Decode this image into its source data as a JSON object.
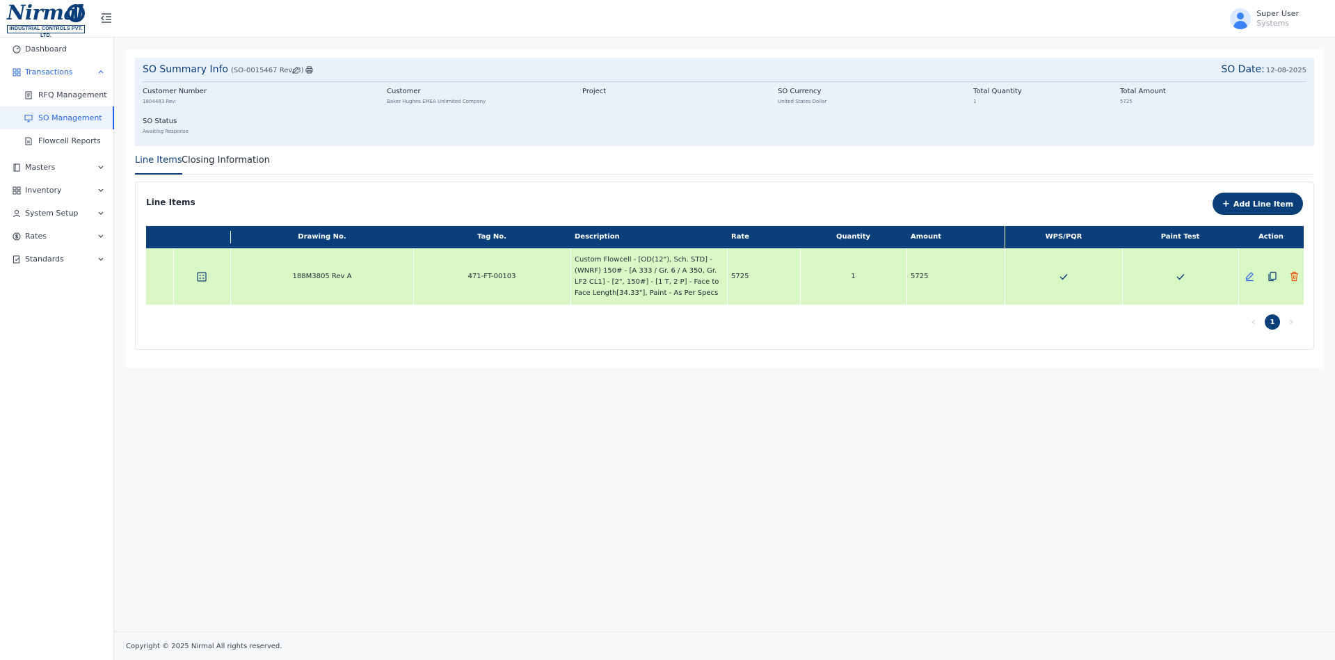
{
  "brand": {
    "logo_word": "Nirmal",
    "logo_sub": "INDUSTRIAL CONTROLS PVT. LTD."
  },
  "header": {
    "user_name": "Super User",
    "user_role": "Systems"
  },
  "sidebar": {
    "items": [
      {
        "label": "Dashboard",
        "icon": "dashboard-icon"
      },
      {
        "label": "Transactions",
        "icon": "grid-icon"
      },
      {
        "label": "RFQ Management",
        "icon": "document-icon"
      },
      {
        "label": "SO Management",
        "icon": "monitor-icon"
      },
      {
        "label": "Flowcell Reports",
        "icon": "report-icon"
      },
      {
        "label": "Masters",
        "icon": "book-icon"
      },
      {
        "label": "Inventory",
        "icon": "grid-icon"
      },
      {
        "label": "System Setup",
        "icon": "user-icon"
      },
      {
        "label": "Rates",
        "icon": "currency-icon"
      },
      {
        "label": "Standards",
        "icon": "standards-icon"
      }
    ]
  },
  "summary": {
    "title": "SO Summary Info",
    "so_ref": "(SO-0015467 Rev: 3)",
    "date_label": "SO Date:",
    "date_value": "12-08-2025",
    "fields": [
      {
        "label": "Customer Number",
        "value": "1804483 Rev:"
      },
      {
        "label": "Customer",
        "value": "Baker Hughes EMEA Unlimited Company"
      },
      {
        "label": "Project",
        "value": ""
      },
      {
        "label": "SO Currency",
        "value": "United States Dollar"
      },
      {
        "label": "Total Quantity",
        "value": "1"
      },
      {
        "label": "Total Amount",
        "value": "5725"
      },
      {
        "label": "SO Status",
        "value": "Awaiting Response"
      }
    ]
  },
  "tabs": [
    {
      "label": "Line Items",
      "active": true
    },
    {
      "label": "Closing Information",
      "active": false
    }
  ],
  "line_items": {
    "title": "Line Items",
    "add_label": "Add Line Item",
    "columns": {
      "drawing": "Drawing No.",
      "tag": "Tag No.",
      "description": "Description",
      "rate": "Rate",
      "quantity": "Quantity",
      "amount": "Amount",
      "wps": "WPS/PQR",
      "paint": "Paint Test",
      "action": "Action"
    },
    "rows": [
      {
        "drawing": "188M3805 Rev A",
        "tag": "471-FT-00103",
        "description": "Custom Flowcell - [OD(12\"), Sch. STD] - (WNRF) 150# - [A 333 / Gr. 6 / A 350, Gr. LF2 CL1] - [2\", 150#] - [1 T, 2 P] - Face to Face Length[34.33\"], Paint - As Per Specs",
        "rate": "5725",
        "quantity": "1",
        "amount": "5725",
        "wps_ok": true,
        "paint_ok": true
      }
    ],
    "current_page": "1"
  },
  "footer": {
    "copyright": "Copyright © 2025 Nirmal All rights reserved."
  },
  "colors": {
    "primary": "#0b3f7a",
    "accent": "#2563eb",
    "row_highlight": "#d9f7c4",
    "summary_bg": "#eaf1fb",
    "delete": "#ea580c"
  }
}
